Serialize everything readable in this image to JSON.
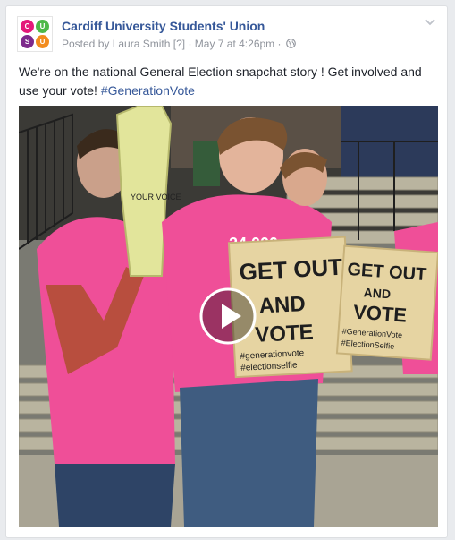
{
  "post": {
    "page_name": "Cardiff University Students' Union",
    "posted_by": "Posted by Laura Smith",
    "info_marker": "[?]",
    "separator": "·",
    "timestamp": "May 7 at 4:26pm",
    "text": "We're on the national General Election snapchat story ! Get involved and use your vote!",
    "hashtag": "#GenerationVote",
    "audience_icon": "globe-icon",
    "menu_icon": "chevron-down-icon"
  },
  "logo": {
    "letters": [
      "C",
      "U",
      "S",
      "U"
    ],
    "colors": [
      "#e3197a",
      "#4db848",
      "#7d2a8c",
      "#f28c1e"
    ]
  },
  "media": {
    "type": "video",
    "play_icon": "play-icon",
    "sign_left": [
      "GET OUT",
      "AND",
      "VOTE",
      "#generationvote",
      "#electionselfie"
    ],
    "sign_right": [
      "GET OUT",
      "AND",
      "VOTE",
      "#GenerationVote",
      "#ElectionSelfie"
    ],
    "shirt_color": "#f0509b"
  },
  "colors": {
    "link": "#365899",
    "text": "#1d2129",
    "meta": "#90949c"
  }
}
